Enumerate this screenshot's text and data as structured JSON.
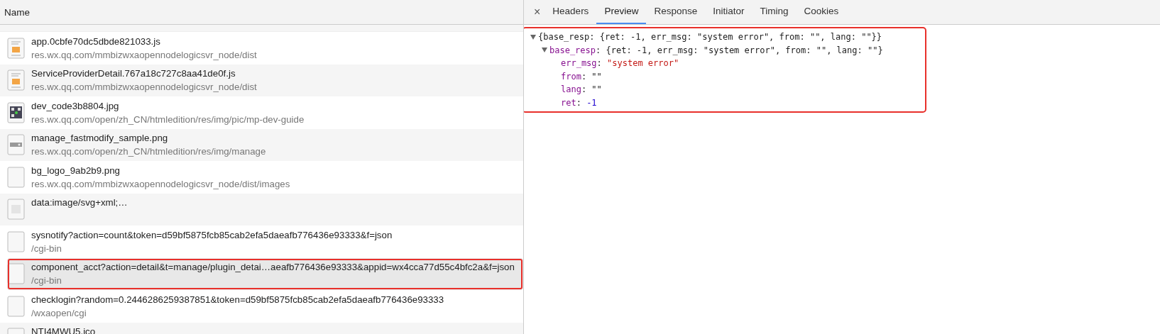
{
  "requests": {
    "column_header": "Name",
    "rows": [
      {
        "name": "app.0cbfe70dc5dbde821033.js",
        "path": "res.wx.qq.com/mmbizwxaopennodelogicsvr_node/dist",
        "kind": "script",
        "selected": false,
        "annotated": false
      },
      {
        "name": "ServiceProviderDetail.767a18c727c8aa41de0f.js",
        "path": "res.wx.qq.com/mmbizwxaopennodelogicsvr_node/dist",
        "kind": "script",
        "selected": false,
        "annotated": false
      },
      {
        "name": "dev_code3b8804.jpg",
        "path": "res.wx.qq.com/open/zh_CN/htmledition/res/img/pic/mp-dev-guide",
        "kind": "qr",
        "selected": false,
        "annotated": false
      },
      {
        "name": "manage_fastmodify_sample.png",
        "path": "res.wx.qq.com/open/zh_CN/htmledition/res/img/manage",
        "kind": "image",
        "selected": false,
        "annotated": false
      },
      {
        "name": "bg_logo_9ab2b9.png",
        "path": "res.wx.qq.com/mmbizwxaopennodelogicsvr_node/dist/images",
        "kind": "blank",
        "selected": false,
        "annotated": false
      },
      {
        "name": "data:image/svg+xml;…",
        "kind": "svg",
        "selected": false,
        "annotated": false
      },
      {
        "name": "sysnotify?action=count&token=d59bf5875fcb85cab2efa5daeafb776436e93333&f=json",
        "path": "/cgi-bin",
        "kind": "blank",
        "selected": false,
        "annotated": false
      },
      {
        "name": "component_acct?action=detail&t=manage/plugin_detai…aeafb776436e93333&appid=wx4cca77d55c4bfc2a&f=json",
        "path": "/cgi-bin",
        "kind": "blank",
        "selected": true,
        "annotated": true
      },
      {
        "name": "checklogin?random=0.2446286259387851&token=d59bf5875fcb85cab2efa5daeafb776436e93333",
        "path": "/wxaopen/cgi",
        "kind": "blank",
        "selected": false,
        "annotated": false
      },
      {
        "name": "NTI4MWU5.ico",
        "kind": "blank",
        "selected": false,
        "annotated": false
      }
    ]
  },
  "detail": {
    "close": "×",
    "tabs": [
      {
        "label": "Headers",
        "selected": false
      },
      {
        "label": "Preview",
        "selected": true
      },
      {
        "label": "Response",
        "selected": false
      },
      {
        "label": "Initiator",
        "selected": false
      },
      {
        "label": "Timing",
        "selected": false
      },
      {
        "label": "Cookies",
        "selected": false
      }
    ],
    "annotated": true,
    "tree": [
      {
        "summary": "{base_resp: {ret: -1, err_msg: \"system error\", from: \"\", lang: \"\"}}",
        "expanded": true,
        "children": [
          {
            "key": "base_resp",
            "colon": ":",
            "summary": "{ret: -1, err_msg: \"system error\", from: \"\", lang: \"\"}",
            "expanded": true,
            "children": [
              {
                "key": "err_msg",
                "colon": ":",
                "value": "\"system error\"",
                "kind": "string"
              },
              {
                "key": "from",
                "colon": ":",
                "value": "\"\"",
                "kind": "empty"
              },
              {
                "key": "lang",
                "colon": ":",
                "value": "\"\"",
                "kind": "empty"
              },
              {
                "key": "ret",
                "colon": ":",
                "value": "-1",
                "kind": "number"
              }
            ]
          }
        ]
      }
    ]
  }
}
